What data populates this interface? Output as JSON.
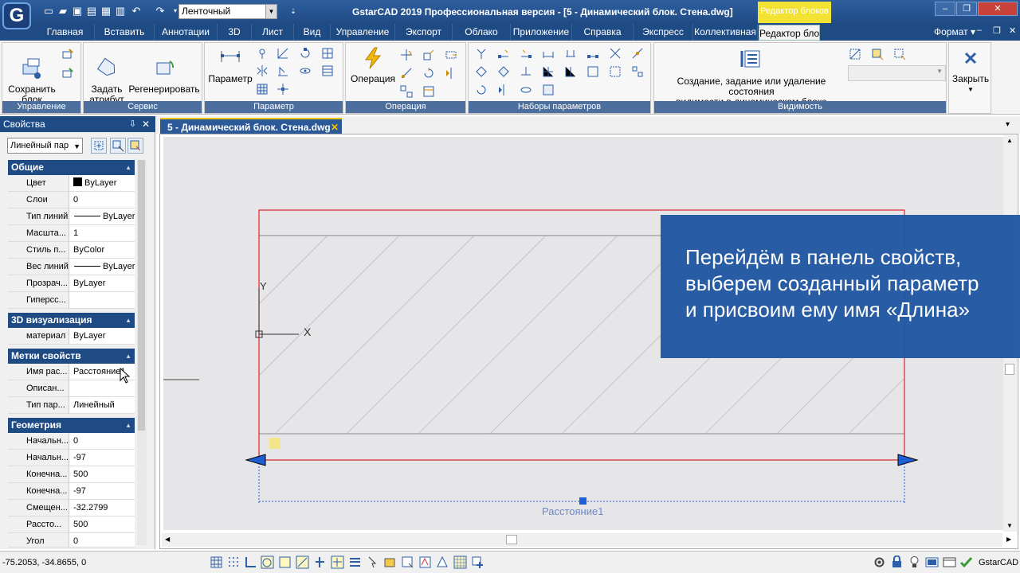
{
  "title_bar": {
    "app_title": "GstarCAD 2019 Профессиональная версия - [5 - Динамический блок. Стена.dwg]",
    "workspace": "Ленточный",
    "context_tab": "Редактор блоков"
  },
  "tabs": [
    "Главная",
    "Вставить",
    "Аннотации",
    "3D",
    "Лист",
    "Вид",
    "Управление",
    "Экспорт",
    "Облако",
    "Приложение",
    "Справка",
    "Экспресс",
    "Коллективная",
    "Редактор бло"
  ],
  "format_menu": "Формат",
  "ribbon": {
    "panels": {
      "upravlenie": {
        "title": "Управление",
        "save_block": "Сохранить\nблок"
      },
      "servis": {
        "title": "Сервис",
        "define_attribute": "Задать\nатрибут",
        "regenerate": "Регенерировать"
      },
      "parameter": {
        "title": "Параметр",
        "parameter_btn": "Параметр"
      },
      "operation": {
        "title": "Операция",
        "operation_btn": "Операция"
      },
      "param_sets": {
        "title": "Наборы параметров"
      },
      "visibility": {
        "title": "Видимость",
        "desc": "Создание, задание или удаление состояния\nвидимости в динамическом блоке"
      },
      "close": {
        "label": "Закрыть"
      }
    }
  },
  "properties_panel": {
    "title": "Свойства",
    "selector": "Линейный пар",
    "sections": [
      {
        "name": "Общие",
        "rows": [
          {
            "k": "Цвет",
            "v": "ByLayer"
          },
          {
            "k": "Слои",
            "v": "0"
          },
          {
            "k": "Тип линий",
            "v": "ByLayer"
          },
          {
            "k": "Масшта...",
            "v": "1"
          },
          {
            "k": "Стиль п...",
            "v": "ByColor"
          },
          {
            "k": "Вес линий",
            "v": "ByLayer"
          },
          {
            "k": "Прозрач...",
            "v": "ByLayer"
          },
          {
            "k": "Гиперсс...",
            "v": ""
          }
        ]
      },
      {
        "name": "3D визуализация",
        "rows": [
          {
            "k": "материал",
            "v": "ByLayer"
          }
        ]
      },
      {
        "name": "Метки свойств",
        "rows": [
          {
            "k": "Имя рас...",
            "v": "Расстояние1"
          },
          {
            "k": "Описан...",
            "v": ""
          },
          {
            "k": "Тип пар...",
            "v": "Линейный"
          }
        ]
      },
      {
        "name": "Геометрия",
        "rows": [
          {
            "k": "Начальн...",
            "v": "0"
          },
          {
            "k": "Начальн...",
            "v": "-97"
          },
          {
            "k": "Конечна...",
            "v": "500"
          },
          {
            "k": "Конечна...",
            "v": "-97"
          },
          {
            "k": "Смещен...",
            "v": "-32.2799"
          },
          {
            "k": "Рассто...",
            "v": "500"
          },
          {
            "k": "Угол",
            "v": "0"
          }
        ]
      }
    ]
  },
  "document_tab": "5 - Динамический блок. Стена.dwg",
  "drawing": {
    "ucs_x": "X",
    "ucs_y": "Y",
    "dimension_label": "Расстояние1"
  },
  "overlay_text": [
    "Перейдём в панель свойств,",
    "выберем созданный параметр",
    "и присвоим ему имя «Длина»"
  ],
  "status": {
    "coords": "-75.2053, -34.8655, 0",
    "brand": "GstarCAD"
  },
  "colors": {
    "title_blue": "#1f4b85",
    "overlay_blue": "#2258a2",
    "context_yellow": "#f2e233",
    "block_red": "#d9232e",
    "dim_blue": "#1e5fd6"
  }
}
